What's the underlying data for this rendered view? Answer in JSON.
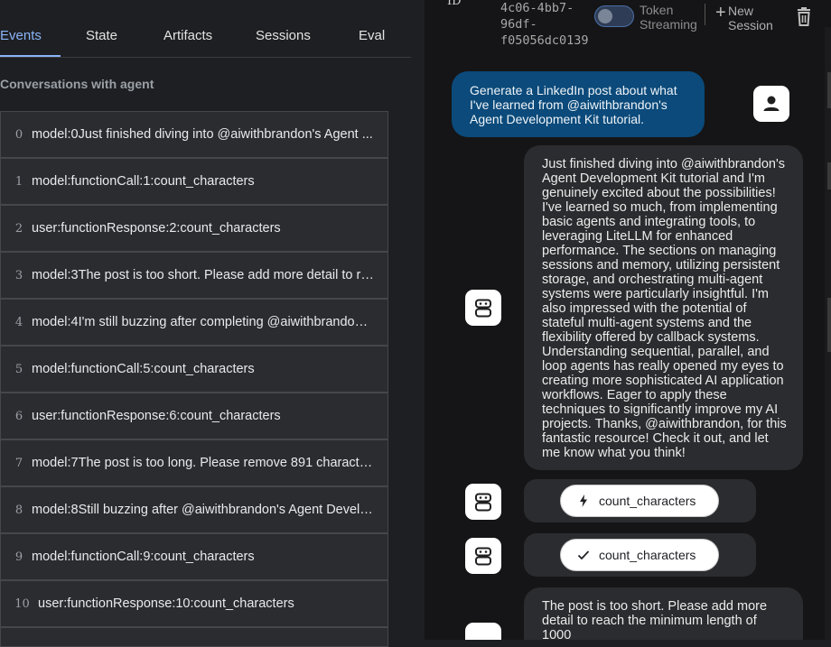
{
  "tabs": [
    "Events",
    "State",
    "Artifacts",
    "Sessions",
    "Eval"
  ],
  "conversation_title": "Conversations with agent",
  "events": [
    {
      "index": "0",
      "text": "model:0Just finished diving into @aiwithbrandon's Agent ..."
    },
    {
      "index": "1",
      "text": "model:functionCall:1:count_characters"
    },
    {
      "index": "2",
      "text": "user:functionResponse:2:count_characters"
    },
    {
      "index": "3",
      "text": "model:3The post is too short. Please add more detail to re..."
    },
    {
      "index": "4",
      "text": "model:4I'm still buzzing after completing @aiwithbrandon'..."
    },
    {
      "index": "5",
      "text": "model:functionCall:5:count_characters"
    },
    {
      "index": "6",
      "text": "user:functionResponse:6:count_characters"
    },
    {
      "index": "7",
      "text": "model:7The post is too long. Please remove 891 character..."
    },
    {
      "index": "8",
      "text": "model:8Still buzzing after @aiwithbrandon's Agent Develo..."
    },
    {
      "index": "9",
      "text": "model:functionCall:9:count_characters"
    },
    {
      "index": "10",
      "text": "user:functionResponse:10:count_characters"
    }
  ],
  "header": {
    "id_label": "ID",
    "session_id": "4c06-4bb7-\n96df-\nf05056dc0139",
    "token_streaming_label": "Token\nStreaming",
    "new_session_label": "New\nSession"
  },
  "chat": {
    "user_message": "Generate a LinkedIn post about what I've learned from @aiwithbrandon's Agent Development Kit tutorial.",
    "bot_message_1": "Just finished diving into @aiwithbrandon's Agent Development Kit tutorial and I'm genuinely excited about the possibilities! I've learned so much, from implementing basic agents and integrating tools, to leveraging LiteLLM for enhanced performance. The sections on managing sessions and memory, utilizing persistent storage, and orchestrating multi-agent systems were particularly insightful. I'm also impressed with the potential of stateful multi-agent systems and the flexibility offered by callback systems. Understanding sequential, parallel, and loop agents has really opened my eyes to creating more sophisticated AI application workflows. Eager to apply these techniques to significantly improve my AI projects. Thanks, @aiwithbrandon, for this fantastic resource! Check it out, and let me know what you think!",
    "function_call_label": "count_characters",
    "function_response_label": "count_characters",
    "bot_message_2": "The post is too short. Please add more detail to reach the minimum length of 1000"
  },
  "colors": {
    "accent": "#8ab4f8",
    "user_bubble": "#0b4a7a",
    "panel_bg": "#1e1f22",
    "chat_bg": "#151517",
    "bubble_bg": "#2b2c2f"
  }
}
